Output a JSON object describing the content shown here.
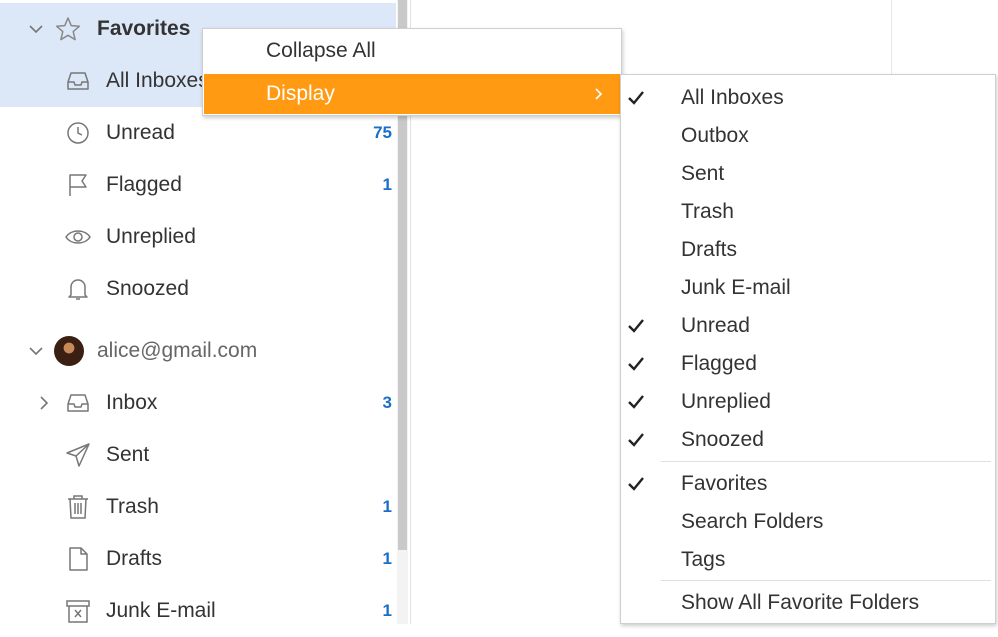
{
  "favorites": {
    "label": "Favorites",
    "items": [
      {
        "label": "All Inboxes",
        "count": ""
      },
      {
        "label": "Unread",
        "count": "75"
      },
      {
        "label": "Flagged",
        "count": "1"
      },
      {
        "label": "Unreplied",
        "count": ""
      },
      {
        "label": "Snoozed",
        "count": ""
      }
    ]
  },
  "account": {
    "email": "alice@gmail.com",
    "items": [
      {
        "label": "Inbox",
        "count": "3"
      },
      {
        "label": "Sent",
        "count": ""
      },
      {
        "label": "Trash",
        "count": "1"
      },
      {
        "label": "Drafts",
        "count": "1"
      },
      {
        "label": "Junk E-mail",
        "count": "1"
      }
    ]
  },
  "context_menu": {
    "collapse_all": "Collapse All",
    "display": "Display"
  },
  "display_submenu": {
    "items": [
      {
        "label": "All Inboxes",
        "checked": true
      },
      {
        "label": "Outbox",
        "checked": false
      },
      {
        "label": "Sent",
        "checked": false
      },
      {
        "label": "Trash",
        "checked": false
      },
      {
        "label": "Drafts",
        "checked": false
      },
      {
        "label": "Junk E-mail",
        "checked": false
      },
      {
        "label": "Unread",
        "checked": true
      },
      {
        "label": "Flagged",
        "checked": true
      },
      {
        "label": "Unreplied",
        "checked": true
      },
      {
        "label": "Snoozed",
        "checked": true
      },
      {
        "label": "Favorites",
        "checked": true
      },
      {
        "label": "Search Folders",
        "checked": false
      },
      {
        "label": "Tags",
        "checked": false
      },
      {
        "label": "Show All Favorite Folders",
        "checked": false
      }
    ]
  },
  "colors": {
    "selected_bg": "#dce8f8",
    "highlight": "#ff9a12",
    "count": "#1a6fc9"
  }
}
